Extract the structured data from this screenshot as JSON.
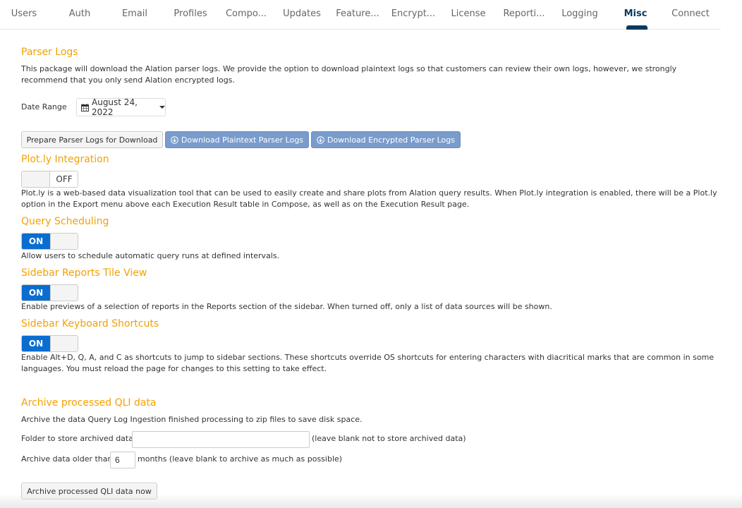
{
  "tabs": [
    {
      "label": "Users",
      "active": false
    },
    {
      "label": "Auth",
      "active": false
    },
    {
      "label": "Email",
      "active": false
    },
    {
      "label": "Profiles",
      "active": false
    },
    {
      "label": "Compo...",
      "active": false
    },
    {
      "label": "Updates",
      "active": false
    },
    {
      "label": "Feature...",
      "active": false
    },
    {
      "label": "Encrypt...",
      "active": false
    },
    {
      "label": "License",
      "active": false
    },
    {
      "label": "Reporti...",
      "active": false
    },
    {
      "label": "Logging",
      "active": false
    },
    {
      "label": "Misc",
      "active": true
    },
    {
      "label": "Connect",
      "active": false
    }
  ],
  "colors": {
    "section_title": "#f5a000",
    "active_tab": "#0b3a5c",
    "toggle_on": "#0a6ed1",
    "primary_button": "#7a9ccc"
  },
  "parser_logs": {
    "title": "Parser Logs",
    "description": "This package will download the Alation parser logs. We provide the option to download plaintext logs so that customers can review their own logs, however, we strongly recommend that you only send Alation encrypted logs.",
    "date_range_label": "Date Range",
    "date_value": "August 24, 2022",
    "prepare_button": "Prepare Parser Logs for Download",
    "download_plaintext_button": "Download Plaintext Parser Logs",
    "download_encrypted_button": "Download Encrypted Parser Logs"
  },
  "plotly": {
    "title": "Plot.ly Integration",
    "toggle_state": "OFF",
    "description": "Plot.ly is a web-based data visualization tool that can be used to easily create and share plots from Alation query results. When Plot.ly integration is enabled, there will be a Plot.ly option in the Export menu above each Execution Result table in Compose, as well as on the Execution Result page."
  },
  "query_scheduling": {
    "title": "Query Scheduling",
    "toggle_state": "ON",
    "description": "Allow users to schedule automatic query runs at defined intervals."
  },
  "sidebar_tile_view": {
    "title": "Sidebar Reports Tile View",
    "toggle_state": "ON",
    "description": "Enable previews of a selection of reports in the Reports section of the sidebar. When turned off, only a list of data sources will be shown."
  },
  "sidebar_shortcuts": {
    "title": "Sidebar Keyboard Shortcuts",
    "toggle_state": "ON",
    "description": "Enable Alt+D, Q, A, and C as shortcuts to jump to sidebar sections. These shortcuts override OS shortcuts for entering characters with diacritical marks that are common in some languages. You must reload the page for changes to this setting to take effect."
  },
  "archive_qli": {
    "title": "Archive processed QLI data",
    "description": "Archive the data Query Log Ingestion finished processing to zip files to save disk space.",
    "folder_label": "Folder to store archived data:",
    "folder_value": "",
    "folder_hint": "(leave blank not to store archived data)",
    "older_than_label": "Archive data older than",
    "months_value": "6",
    "months_hint": "months (leave blank to archive as much as possible)",
    "archive_button": "Archive processed QLI data now"
  }
}
